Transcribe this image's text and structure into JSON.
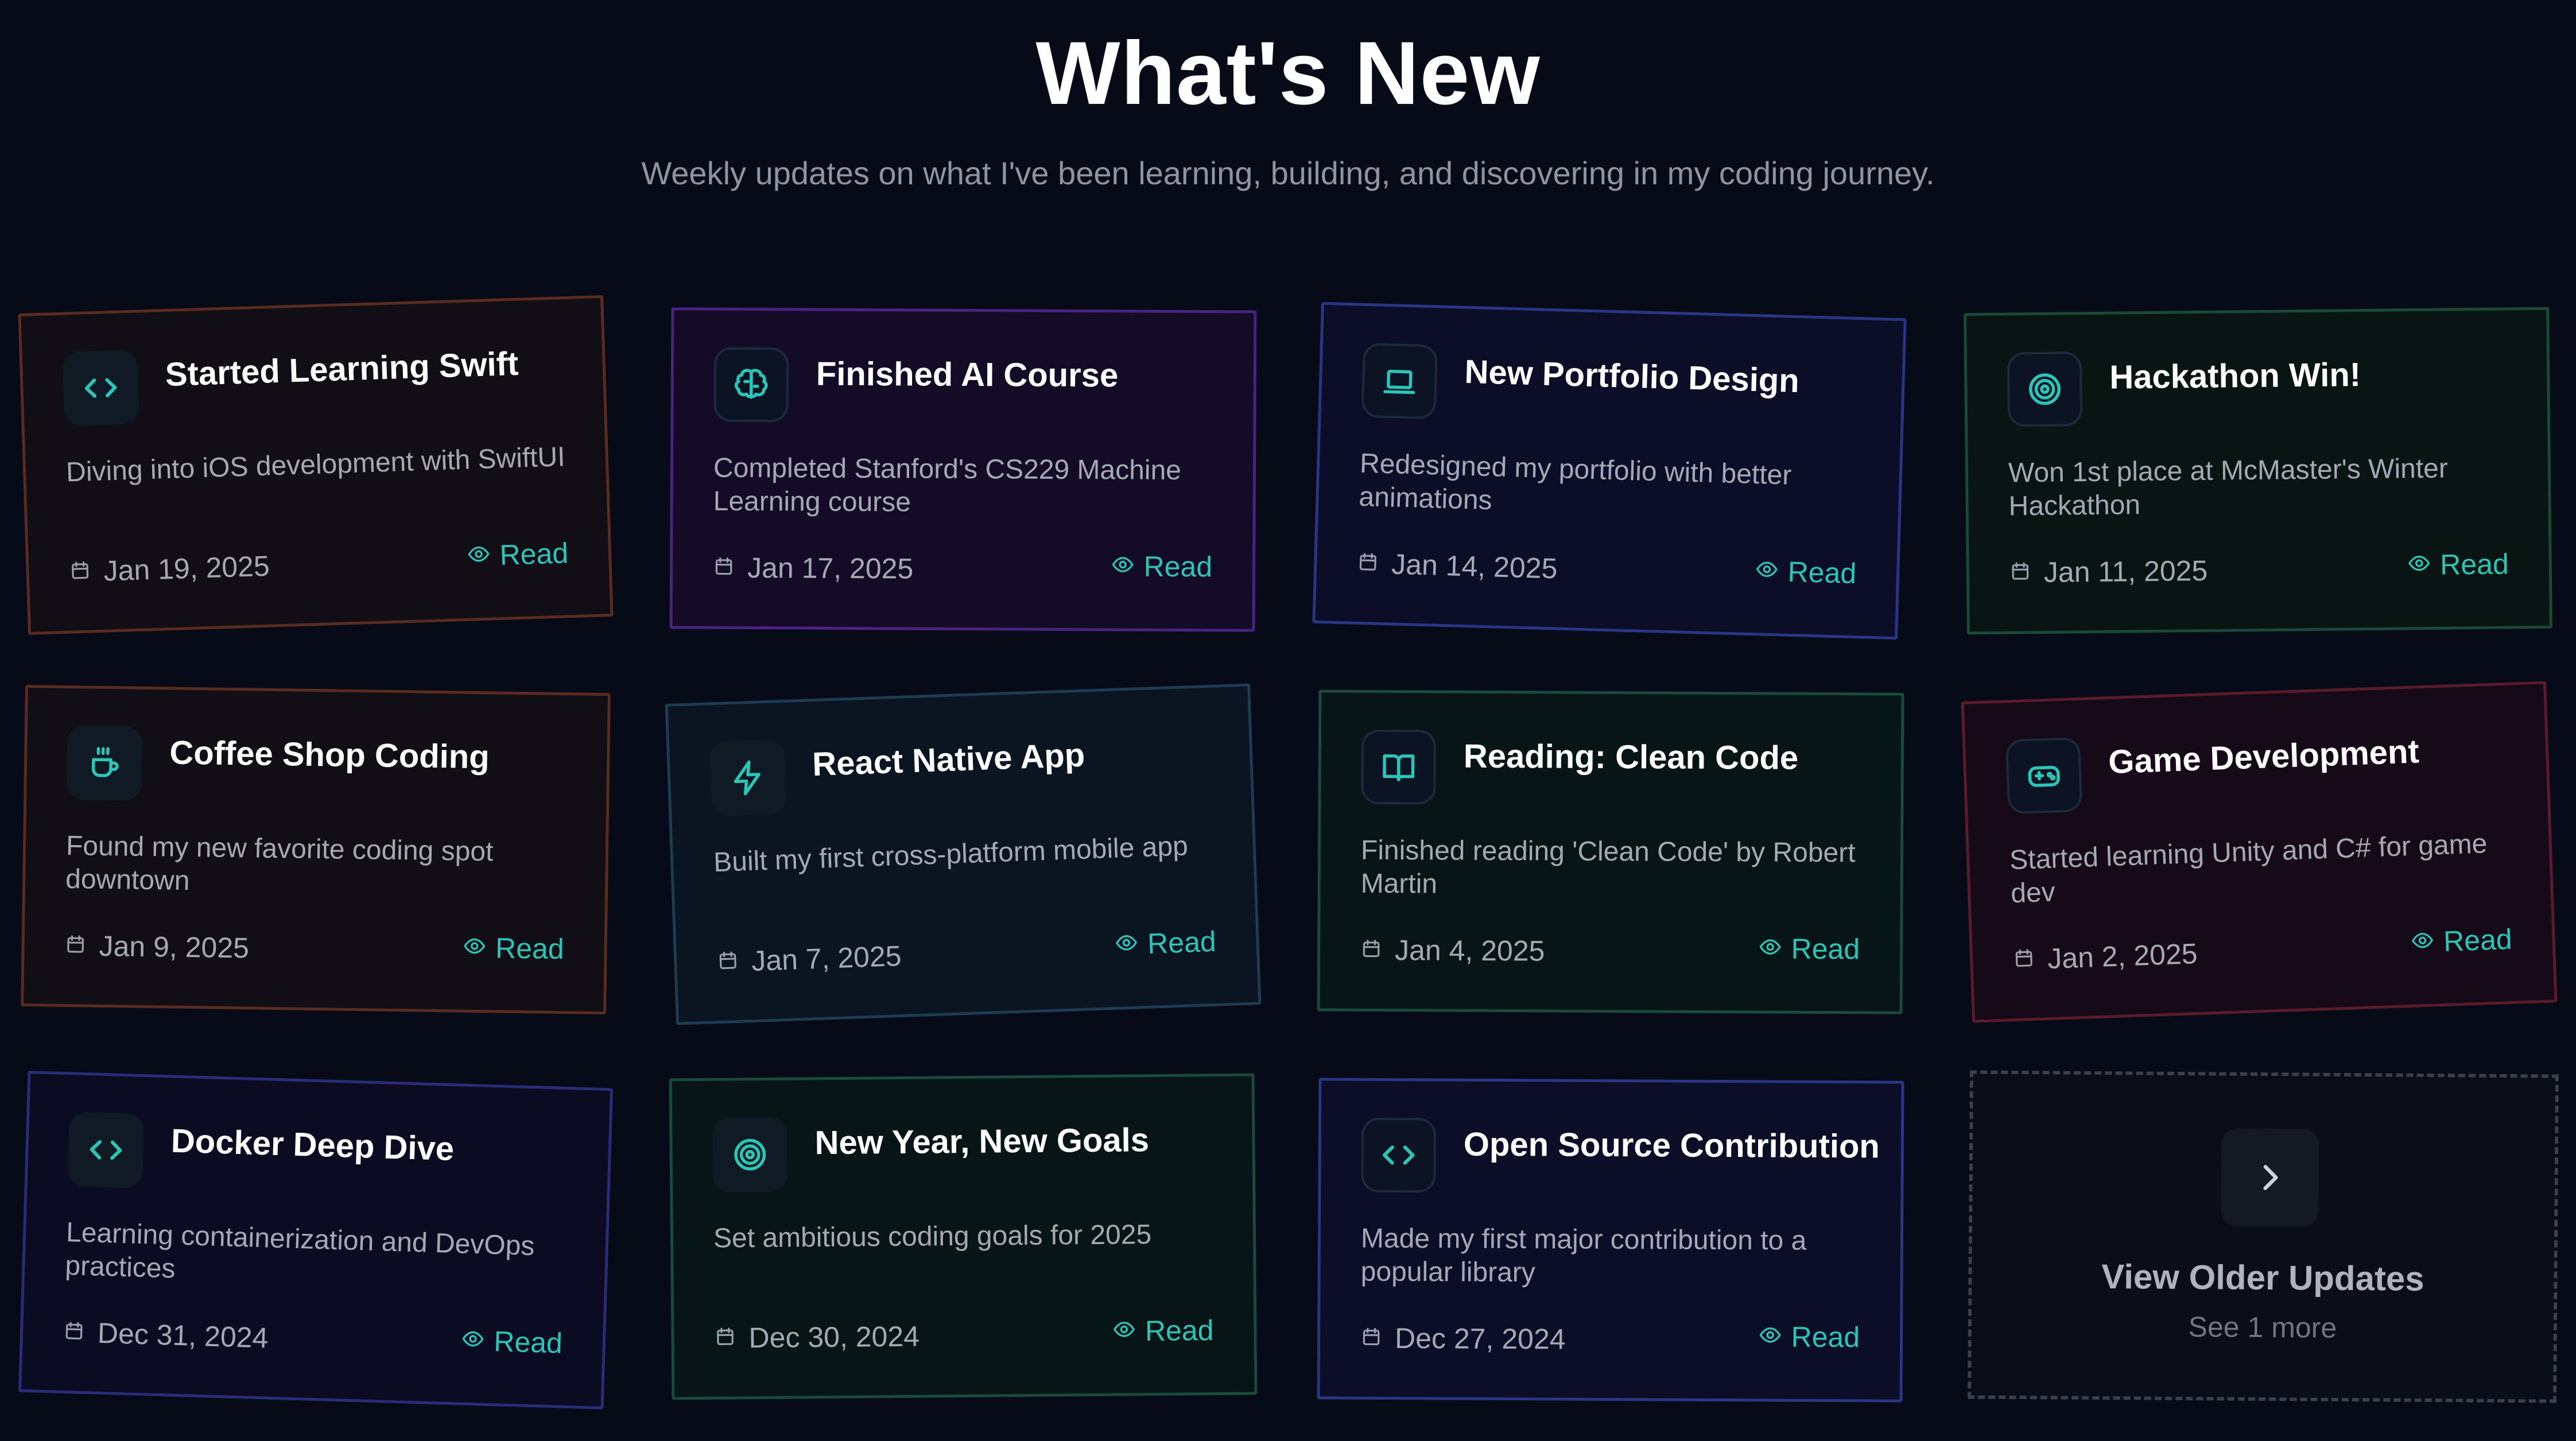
{
  "header": {
    "title": "What's New",
    "subtitle": "Weekly updates on what I've been learning, building, and discovering in my coding journey."
  },
  "read_label": "Read",
  "cards": [
    {
      "title": "Started Learning Swift",
      "description": "Diving into iOS development with SwiftUI",
      "date": "Jan 19, 2025",
      "icon": "code-icon",
      "border_color": "#5a2c20"
    },
    {
      "title": "Finished AI Course",
      "description": "Completed Stanford's CS229 Machine Learning course",
      "date": "Jan 17, 2025",
      "icon": "brain-icon",
      "border_color": "#4a2380"
    },
    {
      "title": "New Portfolio Design",
      "description": "Redesigned my portfolio with better animations",
      "date": "Jan 14, 2025",
      "icon": "laptop-icon",
      "border_color": "#2a3584"
    },
    {
      "title": "Hackathon Win!",
      "description": "Won 1st place at McMaster's Winter Hackathon",
      "date": "Jan 11, 2025",
      "icon": "target-icon",
      "border_color": "#1a4a36"
    },
    {
      "title": "Coffee Shop Coding",
      "description": "Found my new favorite coding spot downtown",
      "date": "Jan 9, 2025",
      "icon": "coffee-icon",
      "border_color": "#5a2c20"
    },
    {
      "title": "React Native App",
      "description": "Built my first cross-platform mobile app",
      "date": "Jan 7, 2025",
      "icon": "lightning-icon",
      "border_color": "#1d3c50"
    },
    {
      "title": "Reading: Clean Code",
      "description": "Finished reading 'Clean Code' by Robert Martin",
      "date": "Jan 4, 2025",
      "icon": "book-icon",
      "border_color": "#1a4a3c"
    },
    {
      "title": "Game Development",
      "description": "Started learning Unity and C# for game dev",
      "date": "Jan 2, 2025",
      "icon": "gamepad-icon",
      "border_color": "#5a1c2a"
    },
    {
      "title": "Docker Deep Dive",
      "description": "Learning containerization and DevOps practices",
      "date": "Dec 31, 2024",
      "icon": "code-icon",
      "border_color": "#2a2c78"
    },
    {
      "title": "New Year, New Goals",
      "description": "Set ambitious coding goals for 2025",
      "date": "Dec 30, 2024",
      "icon": "target-icon",
      "border_color": "#1a4a3c"
    },
    {
      "title": "Open Source Contribution",
      "description": "Made my first major contribution to a popular library",
      "date": "Dec 27, 2024",
      "icon": "code-icon",
      "border_color": "#2a3584"
    }
  ],
  "older": {
    "title": "View Older Updates",
    "subtitle": "See 1 more"
  },
  "colors": {
    "background": "#070b17",
    "accent": "#2cc4b7"
  }
}
